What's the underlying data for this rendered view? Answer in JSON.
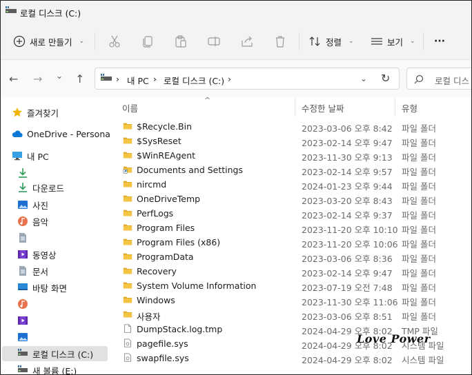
{
  "window": {
    "title": "로컬 디스크 (C:)"
  },
  "toolbar": {
    "new_label": "새로 만들기",
    "sort_label": "정렬",
    "view_label": "보기",
    "more": "···"
  },
  "nav": {
    "back": "←",
    "forward": "→",
    "recent": "⌄",
    "up": "↑",
    "dropdown": "⌄",
    "refresh": "↻"
  },
  "breadcrumb": [
    "›",
    "내 PC",
    "›",
    "로컬 디스크 (C:)",
    "›"
  ],
  "search": {
    "placeholder": "로컬 디스"
  },
  "sidebar": {
    "items": [
      {
        "label": "즐겨찾기",
        "icon": "star-icon"
      },
      {
        "label": "OneDrive - Personal",
        "icon": "cloud-icon"
      },
      {
        "label": "내 PC",
        "icon": "monitor-icon"
      },
      {
        "label": "",
        "icon": "download-icon"
      },
      {
        "label": "다운로드",
        "icon": "download-icon"
      },
      {
        "label": "사진",
        "icon": "pictures-icon"
      },
      {
        "label": "음악",
        "icon": "music-icon"
      },
      {
        "label": "",
        "icon": "document-icon"
      },
      {
        "label": "동영상",
        "icon": "video-icon"
      },
      {
        "label": "문서",
        "icon": "document-icon"
      },
      {
        "label": "바탕 화면",
        "icon": "desktop-icon"
      },
      {
        "label": "",
        "icon": "music-icon"
      },
      {
        "label": "",
        "icon": "video-icon"
      },
      {
        "label": "",
        "icon": "pictures-icon"
      },
      {
        "label": "로컬 디스크 (C:)",
        "icon": "drive-icon"
      },
      {
        "label": "새 볼륨 (E:)",
        "icon": "drive-icon"
      }
    ]
  },
  "columns": {
    "name": "이름",
    "date": "수정한 날짜",
    "type": "유형",
    "sort_indicator": "^"
  },
  "files": [
    {
      "name": "$Recycle.Bin",
      "date": "2023-03-06 오후 8:42",
      "type": "파일 폴더",
      "icon": "folder-icon"
    },
    {
      "name": "$SysReset",
      "date": "2023-02-14 오후 9:47",
      "type": "파일 폴더",
      "icon": "folder-icon"
    },
    {
      "name": "$WinREAgent",
      "date": "2023-11-30 오후 9:13",
      "type": "파일 폴더",
      "icon": "folder-icon"
    },
    {
      "name": "Documents and Settings",
      "date": "2023-02-14 오후 9:57",
      "type": "파일 폴더",
      "icon": "folder-shortcut-icon"
    },
    {
      "name": "nircmd",
      "date": "2024-01-23 오후 9:44",
      "type": "파일 폴더",
      "icon": "folder-icon"
    },
    {
      "name": "OneDriveTemp",
      "date": "2023-03-20 오후 8:43",
      "type": "파일 폴더",
      "icon": "folder-icon"
    },
    {
      "name": "PerfLogs",
      "date": "2023-02-14 오후 9:37",
      "type": "파일 폴더",
      "icon": "folder-icon"
    },
    {
      "name": "Program Files",
      "date": "2023-11-20 오후 10:10",
      "type": "파일 폴더",
      "icon": "folder-icon"
    },
    {
      "name": "Program Files (x86)",
      "date": "2023-11-20 오후 10:06",
      "type": "파일 폴더",
      "icon": "folder-icon"
    },
    {
      "name": "ProgramData",
      "date": "2023-03-06 오후 8:36",
      "type": "파일 폴더",
      "icon": "folder-icon"
    },
    {
      "name": "Recovery",
      "date": "2023-02-14 오후 9:47",
      "type": "파일 폴더",
      "icon": "folder-icon"
    },
    {
      "name": "System Volume Information",
      "date": "2023-07-19 오전 7:48",
      "type": "파일 폴더",
      "icon": "folder-icon"
    },
    {
      "name": "Windows",
      "date": "2023-11-30 오후 11:06",
      "type": "파일 폴더",
      "icon": "folder-icon"
    },
    {
      "name": "사용자",
      "date": "2023-03-06 오후 8:51",
      "type": "파일 폴더",
      "icon": "folder-icon"
    },
    {
      "name": "DumpStack.log.tmp",
      "date": "2024-04-29 오후 8:02",
      "type": "TMP 파일",
      "icon": "file-icon"
    },
    {
      "name": "pagefile.sys",
      "date": "2024-04-29 오후 8:02",
      "type": "시스템 파일",
      "icon": "system-file-icon"
    },
    {
      "name": "swapfile.sys",
      "date": "2024-04-29 오후 8:02",
      "type": "시스템 파일",
      "icon": "system-file-icon"
    }
  ],
  "watermark": "Love Power",
  "colors": {
    "folder": "#f4c443",
    "folder_dark": "#e0a92c",
    "accent": "#0067c0",
    "selected": "#e1e1e1"
  }
}
